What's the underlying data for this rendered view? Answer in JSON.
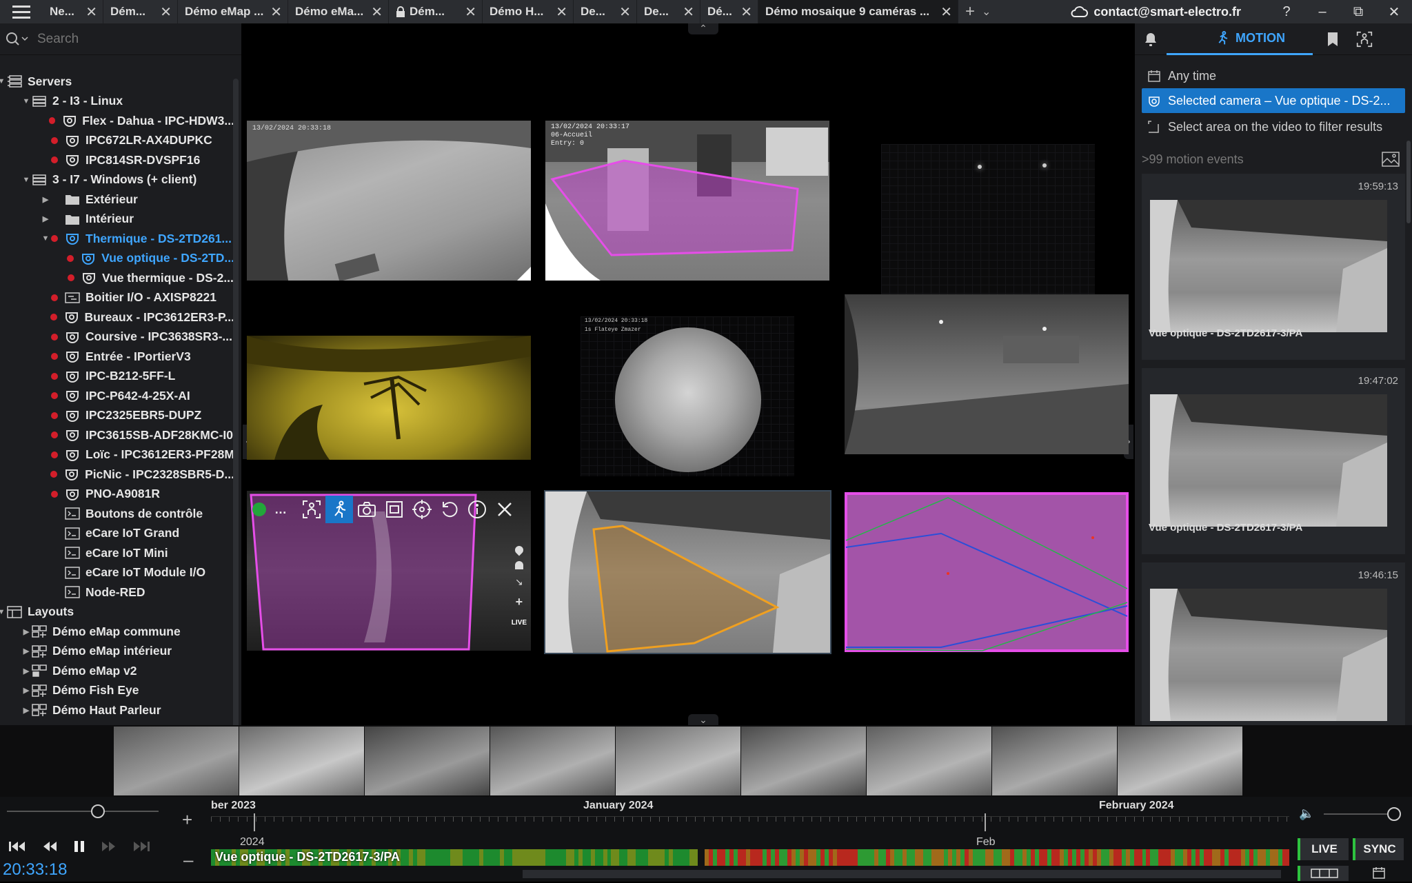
{
  "tabs": [
    {
      "label": "Ne...",
      "w": 88,
      "lock": false
    },
    {
      "label": "Dém...",
      "w": 108,
      "lock": false
    },
    {
      "label": "Démo eMap ...",
      "w": 160,
      "lock": false
    },
    {
      "label": "Démo eMa...",
      "w": 146,
      "lock": false
    },
    {
      "label": "Dém...",
      "w": 136,
      "lock": true
    },
    {
      "label": "Démo H...",
      "w": 132,
      "lock": false
    },
    {
      "label": "De...",
      "w": 92,
      "lock": false
    },
    {
      "label": "De...",
      "w": 92,
      "lock": false
    },
    {
      "label": "Dé...",
      "w": 84,
      "lock": false
    },
    {
      "label": "Démo mosaique 9 caméras ...",
      "w": 290,
      "lock": false,
      "active": true
    }
  ],
  "account": {
    "email": "contact@smart-electro.fr",
    "help": "?"
  },
  "search": {
    "placeholder": "Search"
  },
  "tree": [
    {
      "depth": 0,
      "arrow": "open",
      "icon": "servers",
      "label": "Servers"
    },
    {
      "depth": 1,
      "arrow": "open",
      "icon": "server",
      "label": "2 - I3 - Linux"
    },
    {
      "depth": 2,
      "dot": true,
      "icon": "camera",
      "label": "Flex - Dahua - IPC-HDW3..."
    },
    {
      "depth": 2,
      "dot": true,
      "icon": "camera",
      "label": "IPC672LR-AX4DUPKC"
    },
    {
      "depth": 2,
      "dot": true,
      "icon": "camera",
      "label": "IPC814SR-DVSPF16"
    },
    {
      "depth": 1,
      "arrow": "open",
      "icon": "server",
      "label": "3 - I7 - Windows (+ client)"
    },
    {
      "depth": 2,
      "arrow": "closed",
      "icon": "folder",
      "label": "Extérieur"
    },
    {
      "depth": 2,
      "arrow": "closed",
      "icon": "folder",
      "label": "Intérieur"
    },
    {
      "depth": 2,
      "dot": true,
      "arrow": "open",
      "icon": "camera",
      "label": "Thermique - DS-2TD261...",
      "sel": true
    },
    {
      "depth": 3,
      "dot": true,
      "icon": "camera",
      "label": "Vue optique - DS-2TD...",
      "sel": true
    },
    {
      "depth": 3,
      "dot": true,
      "icon": "camera",
      "label": "Vue thermique - DS-2..."
    },
    {
      "depth": 2,
      "dot": true,
      "icon": "io",
      "label": "Boitier I/O - AXISP8221"
    },
    {
      "depth": 2,
      "dot": true,
      "icon": "camera",
      "label": "Bureaux - IPC3612ER3-P..."
    },
    {
      "depth": 2,
      "dot": true,
      "icon": "camera",
      "label": "Coursive - IPC3638SR3-..."
    },
    {
      "depth": 2,
      "dot": true,
      "icon": "camera",
      "label": "Entrée - IPortierV3"
    },
    {
      "depth": 2,
      "dot": true,
      "icon": "camera",
      "label": "IPC-B212-5FF-L"
    },
    {
      "depth": 2,
      "dot": true,
      "icon": "camera",
      "label": "IPC-P642-4-25X-AI"
    },
    {
      "depth": 2,
      "dot": true,
      "icon": "camera",
      "label": "IPC2325EBR5-DUPZ"
    },
    {
      "depth": 2,
      "dot": true,
      "icon": "camera",
      "label": "IPC3615SB-ADF28KMC-I0"
    },
    {
      "depth": 2,
      "dot": true,
      "icon": "camera",
      "label": "Loïc - IPC3612ER3-PF28M"
    },
    {
      "depth": 2,
      "dot": true,
      "icon": "camera",
      "label": "PicNic - IPC2328SBR5-D..."
    },
    {
      "depth": 2,
      "dot": true,
      "icon": "camera",
      "label": "PNO-A9081R"
    },
    {
      "depth": 2,
      "icon": "script",
      "label": "Boutons de contrôle"
    },
    {
      "depth": 2,
      "icon": "script",
      "label": "eCare IoT Grand"
    },
    {
      "depth": 2,
      "icon": "script",
      "label": "eCare IoT Mini"
    },
    {
      "depth": 2,
      "icon": "script",
      "label": "eCare IoT Module I/O"
    },
    {
      "depth": 2,
      "icon": "script",
      "label": "Node-RED"
    },
    {
      "depth": 0,
      "arrow": "open",
      "icon": "layouts",
      "label": "Layouts"
    },
    {
      "depth": 1,
      "arrow": "closed",
      "icon": "layout",
      "label": "Démo eMap commune"
    },
    {
      "depth": 1,
      "arrow": "closed",
      "icon": "layout",
      "label": "Démo eMap intérieur"
    },
    {
      "depth": 1,
      "arrow": "closed",
      "icon": "layout-lock",
      "label": "Démo eMap v2"
    },
    {
      "depth": 1,
      "arrow": "closed",
      "icon": "layout",
      "label": "Démo Fish Eye"
    },
    {
      "depth": 1,
      "arrow": "closed",
      "icon": "layout",
      "label": "Démo Haut Parleur"
    }
  ],
  "cams": {
    "c1_osd": "13/02/2024 20:33:18",
    "c2_osd": "13/02/2024 20:33:17",
    "c2_osd2": "06-Accueil",
    "c2_osd3": "Entry: 0",
    "c5_osd": "13/02/2024 20:33:18",
    "c5_osd2": "1s Flateye Zmazer",
    "live": "LIVE"
  },
  "right": {
    "tab_label": "MOTION",
    "filters": [
      "Any time",
      "Selected camera – Vue optique - DS-2...",
      "Select area on the video to filter results"
    ],
    "count": ">99 motion events",
    "events": [
      {
        "time": "19:59:13",
        "name": "Vue optique - DS-2TD2617-3/PA"
      },
      {
        "time": "19:47:02",
        "name": "Vue optique - DS-2TD2617-3/PA"
      },
      {
        "time": "19:46:15",
        "name": ""
      }
    ]
  },
  "timeline": {
    "months": [
      {
        "label": "ber 2023"
      },
      {
        "label": "January 2024"
      },
      {
        "label": "February 2024"
      }
    ],
    "year": "2024",
    "feb": "Feb",
    "cam_label": "Vue optique - DS-2TD2617-3/PA",
    "clock": "20:33:18",
    "live": "LIVE",
    "sync": "SYNC"
  },
  "colors": {
    "accent": "#3fa6ff",
    "offline": "#d31e2a",
    "zone": "#d34bd8",
    "online": "#2ec33f"
  }
}
